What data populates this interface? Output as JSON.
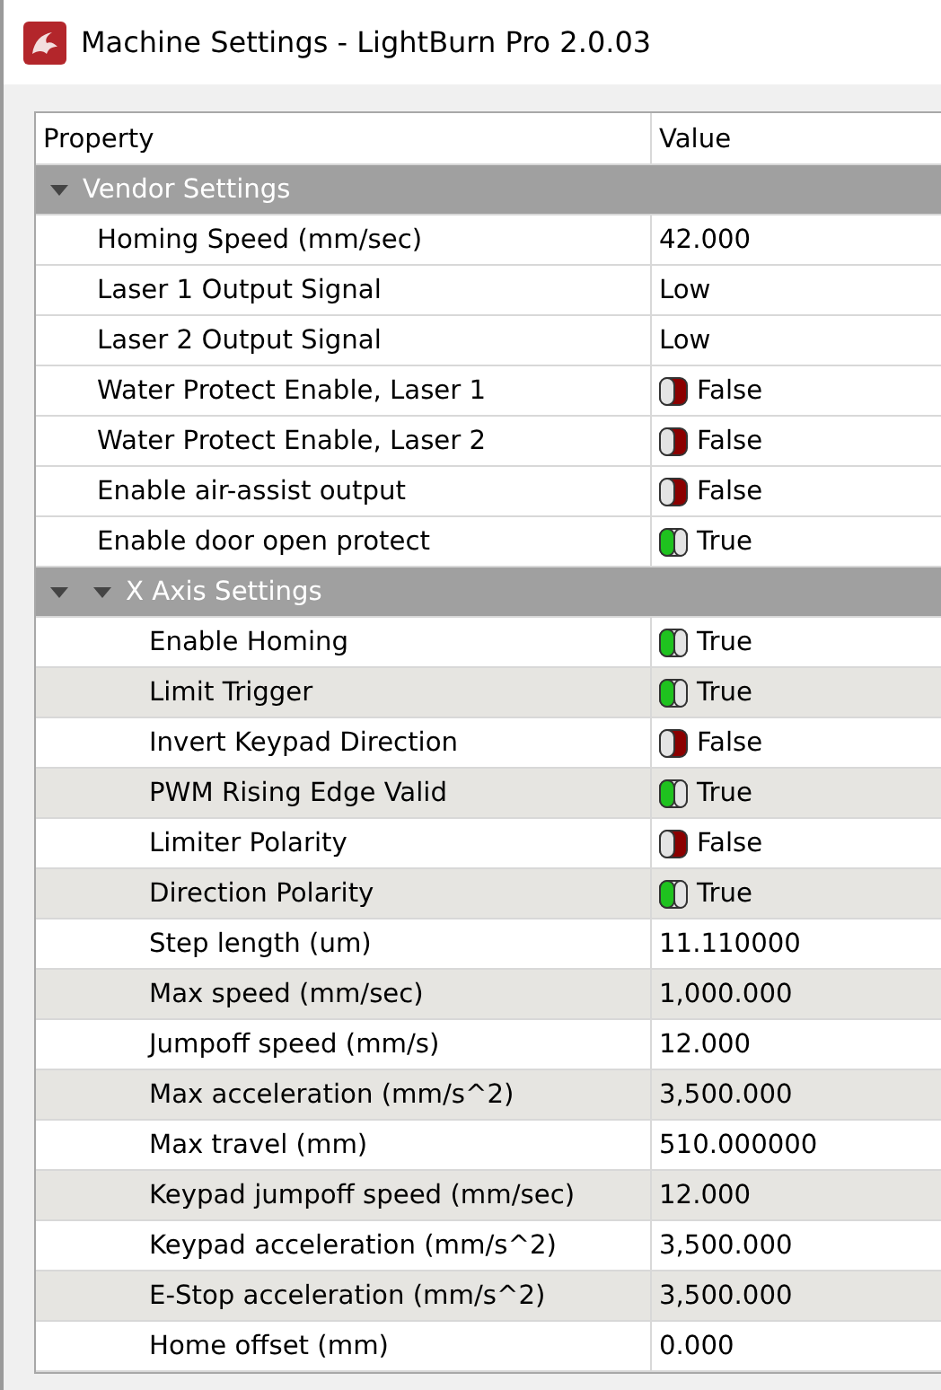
{
  "window": {
    "title": "Machine Settings - LightBurn Pro 2.0.03"
  },
  "table": {
    "columns": [
      "Property",
      "Value"
    ],
    "rows": [
      {
        "kind": "group",
        "label": "Vendor Settings",
        "expanded": true,
        "children": [
          {
            "kind": "text",
            "label": "Homing Speed (mm/sec)",
            "value": "42.000",
            "shaded": false
          },
          {
            "kind": "text",
            "label": "Laser 1 Output Signal",
            "value": "Low",
            "shaded": false
          },
          {
            "kind": "text",
            "label": "Laser 2 Output Signal",
            "value": "Low",
            "shaded": false
          },
          {
            "kind": "toggle",
            "label": "Water Protect Enable, Laser 1",
            "on": false,
            "value": "False",
            "shaded": false
          },
          {
            "kind": "toggle",
            "label": "Water Protect Enable, Laser 2",
            "on": false,
            "value": "False",
            "shaded": false
          },
          {
            "kind": "toggle",
            "label": "Enable air-assist output",
            "on": false,
            "value": "False",
            "shaded": false
          },
          {
            "kind": "toggle",
            "label": "Enable door open protect",
            "on": true,
            "value": "True",
            "shaded": false
          },
          {
            "kind": "group",
            "label": "X Axis Settings",
            "expanded": true,
            "children": [
              {
                "kind": "toggle",
                "label": "Enable Homing",
                "on": true,
                "value": "True",
                "shaded": false
              },
              {
                "kind": "toggle",
                "label": "Limit Trigger",
                "on": true,
                "value": "True",
                "shaded": true
              },
              {
                "kind": "toggle",
                "label": "Invert Keypad Direction",
                "on": false,
                "value": "False",
                "shaded": false
              },
              {
                "kind": "toggle",
                "label": "PWM Rising Edge Valid",
                "on": true,
                "value": "True",
                "shaded": true
              },
              {
                "kind": "toggle",
                "label": "Limiter Polarity",
                "on": false,
                "value": "False",
                "shaded": false
              },
              {
                "kind": "toggle",
                "label": "Direction Polarity",
                "on": true,
                "value": "True",
                "shaded": true
              },
              {
                "kind": "text",
                "label": "Step length (um)",
                "value": "11.110000",
                "shaded": false
              },
              {
                "kind": "text",
                "label": "Max speed (mm/sec)",
                "value": "1,000.000",
                "shaded": true
              },
              {
                "kind": "text",
                "label": "Jumpoff speed (mm/s)",
                "value": "12.000",
                "shaded": false
              },
              {
                "kind": "text",
                "label": "Max acceleration (mm/s^2)",
                "value": "3,500.000",
                "shaded": true
              },
              {
                "kind": "text",
                "label": "Max travel (mm)",
                "value": "510.000000",
                "shaded": false
              },
              {
                "kind": "text",
                "label": "Keypad jumpoff speed (mm/sec)",
                "value": "12.000",
                "shaded": true
              },
              {
                "kind": "text",
                "label": "Keypad acceleration (mm/s^2)",
                "value": "3,500.000",
                "shaded": false
              },
              {
                "kind": "text",
                "label": "E-Stop acceleration (mm/s^2)",
                "value": "3,500.000",
                "shaded": true
              },
              {
                "kind": "text",
                "label": "Home offset (mm)",
                "value": "0.000",
                "shaded": false
              }
            ]
          }
        ]
      }
    ]
  }
}
